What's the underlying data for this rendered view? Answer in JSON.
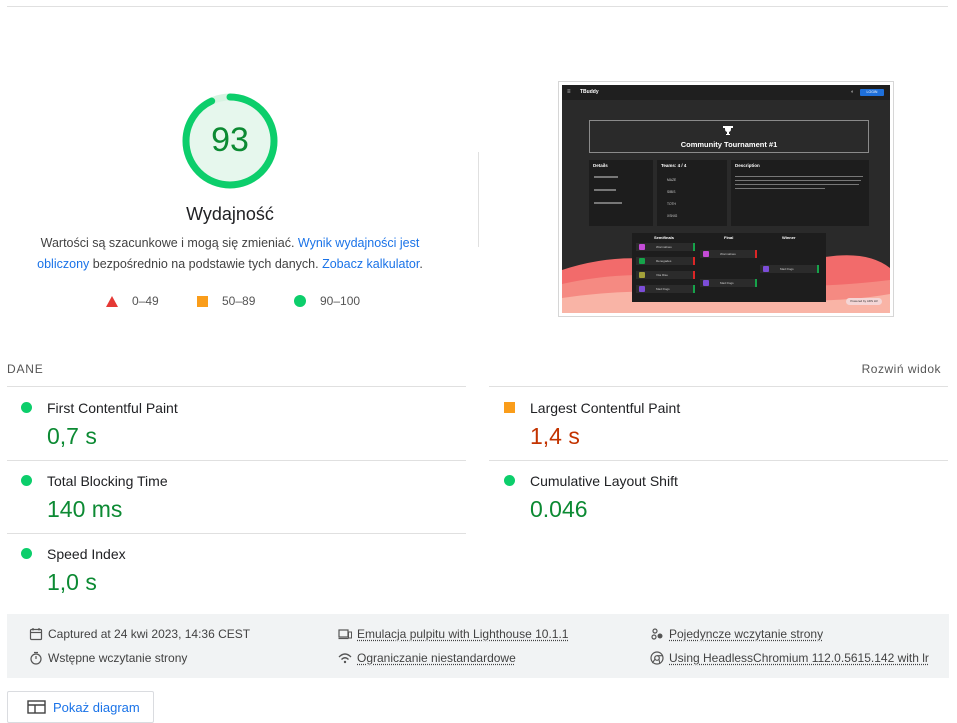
{
  "performance": {
    "score": "93",
    "score_fraction": 0.93,
    "title": "Wydajność",
    "desc_prefix": "Wartości są szacunkowe i mogą się zmieniać. ",
    "desc_link1": "Wynik wydajności jest obliczony",
    "desc_middle": " bezpośrednio na podstawie tych danych. ",
    "desc_link2": "Zobacz kalkulator",
    "desc_suffix": ".",
    "legend": [
      {
        "shape": "triangle",
        "label": "0–49",
        "color": "#e53935"
      },
      {
        "shape": "square",
        "label": "50–89",
        "color": "#fa9d1a"
      },
      {
        "shape": "circle",
        "label": "90–100",
        "color": "#0cce6b"
      }
    ]
  },
  "thumbnail": {
    "brand": "TBuddy",
    "login": "LOGIN",
    "banner_title": "Community Tournament #1",
    "details_title": "Details",
    "teams_title": "Teams: 4 / 4",
    "teams": [
      "MAZE",
      "SIBIS",
      "TOTH",
      "XSNIG"
    ],
    "description_title": "Description",
    "bracket_heads": [
      "Semifinals",
      "Final",
      "Winner"
    ],
    "bracket_names": [
      "Wormalines",
      "Renegades",
      "Vita Rise",
      "Mad Dogs"
    ],
    "final_names": [
      "Wormalines",
      "Mad Dogs"
    ],
    "winner_name": "Mad Dogs",
    "powered": "Powered by ADS LR"
  },
  "metrics": {
    "section_label": "DANE",
    "expand_label": "Rozwiń widok",
    "items": [
      {
        "name": "First Contentful Paint",
        "value": "0,7 s",
        "status": "good"
      },
      {
        "name": "Largest Contentful Paint",
        "value": "1,4 s",
        "status": "average"
      },
      {
        "name": "Total Blocking Time",
        "value": "140 ms",
        "status": "good"
      },
      {
        "name": "Cumulative Layout Shift",
        "value": "0.046",
        "status": "good"
      },
      {
        "name": "Speed Index",
        "value": "1,0 s",
        "status": "good"
      }
    ]
  },
  "runtime": {
    "captured": "Captured at 24 kwi 2023, 14:36 CEST",
    "initial_load": "Wstępne wczytanie strony",
    "emulation": "Emulacja pulpitu with Lighthouse 10.1.1",
    "throttling": "Ograniczanie niestandardowe",
    "single_load": "Pojedyncze wczytanie strony",
    "browser": "Using HeadlessChromium 112.0.5615.142 with lr"
  },
  "diagram_button": "Pokaż diagram",
  "colors": {
    "good": "#0cce6b",
    "good_text": "#0c8a33",
    "average": "#fa9d1a",
    "average_text": "#c33300",
    "poor": "#e53935",
    "link": "#1a73e8"
  }
}
